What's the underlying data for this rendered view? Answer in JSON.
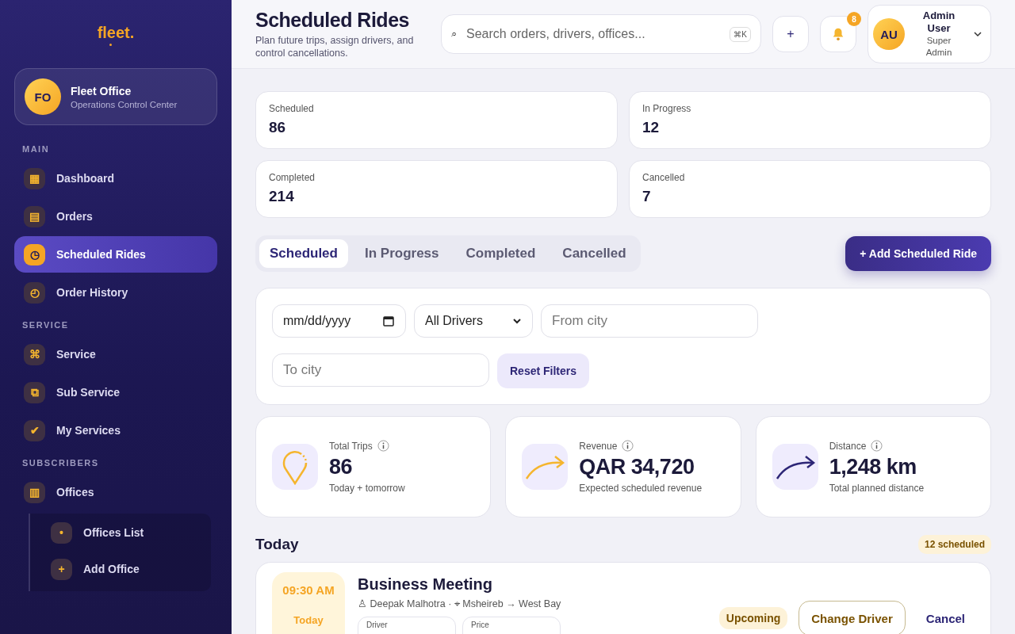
{
  "sidebar": {
    "logo": "fleet.",
    "office": {
      "initials": "FO",
      "name": "Fleet Office",
      "subtitle": "Operations Control Center"
    },
    "sections": [
      {
        "title": "MAIN",
        "items": [
          {
            "icon": "▦",
            "label": "Dashboard",
            "selected": false
          },
          {
            "icon": "▤",
            "label": "Orders",
            "selected": false
          },
          {
            "icon": "◷",
            "label": "Scheduled Rides",
            "selected": true
          },
          {
            "icon": "◴",
            "label": "Order History",
            "selected": false
          }
        ]
      },
      {
        "title": "SERVICE",
        "items": [
          {
            "icon": "⌘",
            "label": "Service",
            "selected": false
          },
          {
            "icon": "⧉",
            "label": "Sub Service",
            "selected": false
          },
          {
            "icon": "✔",
            "label": "My Services",
            "selected": false
          }
        ]
      },
      {
        "title": "SUBSCRIBERS",
        "items": [
          {
            "icon": "▥",
            "label": "Offices",
            "selected": false,
            "expanded": true,
            "children": [
              {
                "icon": "•",
                "label": "Offices List",
                "selected": false
              },
              {
                "icon": "+",
                "label": "Add Office",
                "selected": false
              }
            ]
          }
        ]
      }
    ]
  },
  "header": {
    "title": "Scheduled Rides",
    "subtitle": "Plan future trips, assign drivers, and control cancellations.",
    "search": {
      "icon": "⌕",
      "placeholder": "Search orders, drivers, offices...",
      "shortcut": "⌘K"
    },
    "add_button": "+",
    "notifications": {
      "count": "8"
    },
    "user": {
      "initials": "AU",
      "name": "Admin User",
      "role": "Super Admin"
    }
  },
  "stats": [
    {
      "label": "Scheduled",
      "value": "86"
    },
    {
      "label": "In Progress",
      "value": "12"
    },
    {
      "label": "Completed",
      "value": "214"
    },
    {
      "label": "Cancelled",
      "value": "7"
    }
  ],
  "tabs": [
    {
      "label": "Scheduled",
      "selected": true
    },
    {
      "label": "In Progress",
      "selected": false
    },
    {
      "label": "Completed",
      "selected": false
    },
    {
      "label": "Cancelled",
      "selected": false
    }
  ],
  "add_ride_button": "+ Add Scheduled Ride",
  "filters": {
    "date": {
      "placeholder": "mm/dd/yyyy"
    },
    "driver": {
      "value": "All Drivers"
    },
    "from": {
      "placeholder": "From city"
    },
    "to": {
      "placeholder": "To city"
    },
    "reset": "Reset Filters"
  },
  "metrics": [
    {
      "kind": "pin",
      "label": "Total Trips",
      "value": "86",
      "note": "Today + tomorrow"
    },
    {
      "kind": "route",
      "label": "Revenue",
      "value": "QAR 34,720",
      "note": "Expected scheduled revenue"
    },
    {
      "kind": "distance",
      "label": "Distance",
      "value": "1,248 km",
      "note": "Total planned distance"
    }
  ],
  "today": {
    "title": "Today",
    "count": "12 scheduled",
    "rides": [
      {
        "time": "09:30 AM",
        "day": "Today",
        "title": "Business Meeting",
        "meta": "♙ Deepak Malhotra · ⌖ Msheireb → West Bay",
        "fields": [
          "Driver",
          "Price"
        ],
        "status": "Upcoming",
        "change_button": "Change Driver",
        "cancel_button": "Cancel"
      }
    ]
  }
}
